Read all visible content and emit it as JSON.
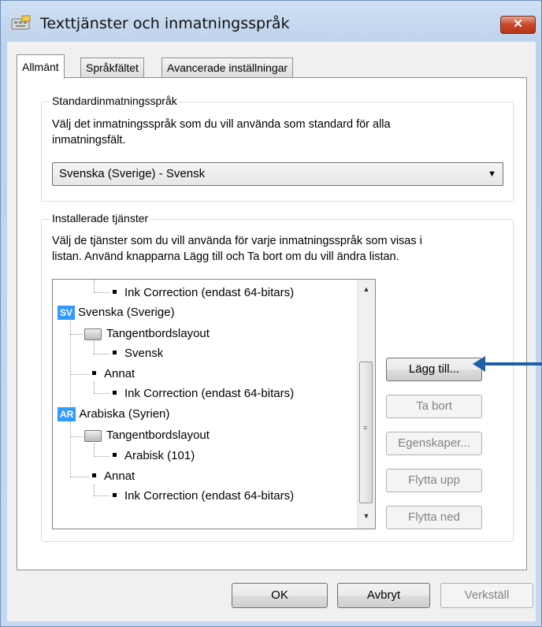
{
  "window": {
    "title": "Texttjänster och inmatningsspråk",
    "close_label": "✕"
  },
  "tabs": [
    {
      "label": "Allmänt",
      "active": true
    },
    {
      "label": "Språkfältet",
      "active": false
    },
    {
      "label": "Avancerade inställningar",
      "active": false
    }
  ],
  "default_input": {
    "legend": "Standardinmatningsspråk",
    "description_line1": "Välj det inmatningsspråk som du vill använda som standard för alla",
    "description_line2": "inmatningsfält.",
    "selected": "Svenska (Sverige) - Svensk"
  },
  "installed_services": {
    "legend": "Installerade tjänster",
    "description_line1": "Välj de tjänster som du vill använda för varje inmatningsspråk som visas i",
    "description_line2": "listan. Använd knapparna Lägg till och Ta bort om du vill ändra listan.",
    "tree": [
      {
        "text": "Ink Correction (endast 64-bitars)",
        "kind": "bullet"
      },
      {
        "text": "Svenska (Sverige)",
        "kind": "lang",
        "badge": "SV"
      },
      {
        "text": "Tangentbordslayout",
        "kind": "keyboard"
      },
      {
        "text": "Svensk",
        "kind": "bullet"
      },
      {
        "text": "Annat",
        "kind": "bullet"
      },
      {
        "text": "Ink Correction (endast 64-bitars)",
        "kind": "bullet"
      },
      {
        "text": "Arabiska (Syrien)",
        "kind": "lang",
        "badge": "AR"
      },
      {
        "text": "Tangentbordslayout",
        "kind": "keyboard"
      },
      {
        "text": "Arabisk (101)",
        "kind": "bullet"
      },
      {
        "text": "Annat",
        "kind": "bullet"
      },
      {
        "text": "Ink Correction (endast 64-bitars)",
        "kind": "bullet"
      }
    ],
    "buttons": {
      "add": "Lägg till...",
      "remove": "Ta bort",
      "properties": "Egenskaper...",
      "move_up": "Flytta upp",
      "move_down": "Flytta ned"
    }
  },
  "footer": {
    "ok": "OK",
    "cancel": "Avbryt",
    "apply": "Verkställ"
  },
  "colors": {
    "badge": "#3399ff",
    "annotation_arrow": "#1f5fa8",
    "close_button": "#c8462a"
  }
}
